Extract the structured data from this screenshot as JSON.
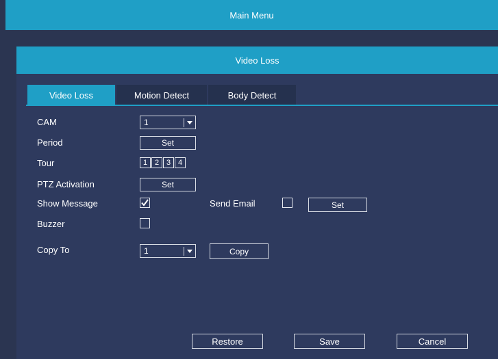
{
  "main_menu": {
    "title": "Main Menu"
  },
  "dialog": {
    "title": "Video Loss"
  },
  "tabs": [
    {
      "label": "Video Loss",
      "active": true
    },
    {
      "label": "Motion Detect",
      "active": false
    },
    {
      "label": "Body Detect",
      "active": false
    }
  ],
  "form": {
    "cam": {
      "label": "CAM",
      "value": "1"
    },
    "period": {
      "label": "Period",
      "button": "Set"
    },
    "tour": {
      "label": "Tour",
      "channels": [
        "1",
        "2",
        "3",
        "4"
      ]
    },
    "ptz": {
      "label": "PTZ Activation",
      "button": "Set"
    },
    "show_message": {
      "label": "Show Message",
      "checked": true
    },
    "send_email": {
      "label": "Send Email",
      "checked": false,
      "button": "Set"
    },
    "buzzer": {
      "label": "Buzzer",
      "checked": false
    },
    "copy_to": {
      "label": "Copy To",
      "value": "1",
      "button": "Copy"
    }
  },
  "footer": {
    "restore": "Restore",
    "save": "Save",
    "cancel": "Cancel"
  },
  "colors": {
    "accent": "#1f9fc6",
    "background": "#2b3551",
    "panel": "#2e3a5e"
  }
}
